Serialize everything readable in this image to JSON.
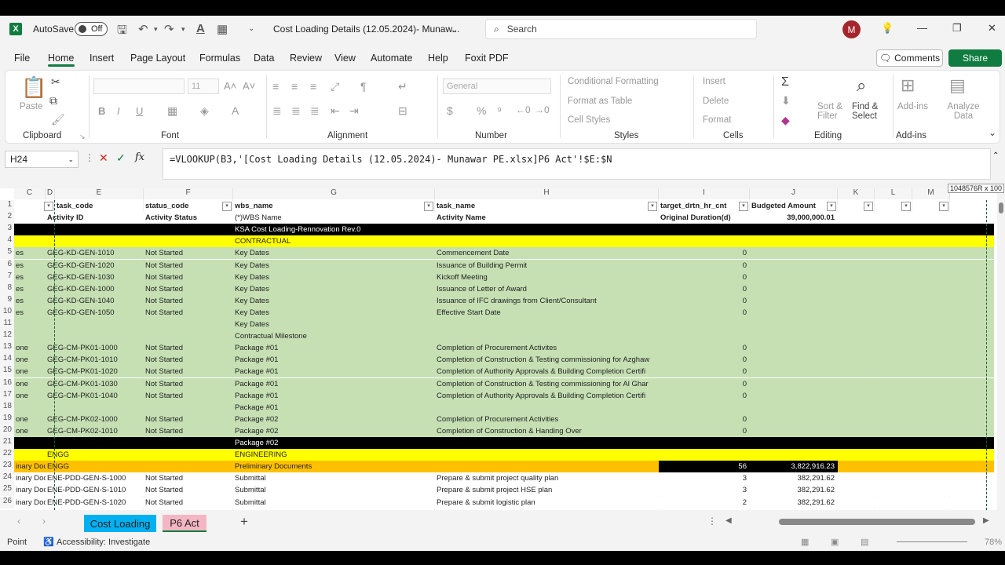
{
  "titlebar": {
    "autosave_label": "AutoSave",
    "autosave_state": "Off",
    "document_title": "Cost Loading Details (12.05.2024)- Munaw...",
    "search_placeholder": "Search",
    "avatar_initial": "M"
  },
  "menu": {
    "items": [
      "File",
      "Home",
      "Insert",
      "Page Layout",
      "Formulas",
      "Data",
      "Review",
      "View",
      "Automate",
      "Help",
      "Foxit PDF"
    ],
    "active": "Home",
    "comments_label": "Comments",
    "share_label": "Share"
  },
  "ribbon": {
    "clipboard": {
      "paste": "Paste",
      "label": "Clipboard"
    },
    "font": {
      "size": "11",
      "label": "Font"
    },
    "alignment": {
      "label": "Alignment"
    },
    "number": {
      "format": "General",
      "label": "Number"
    },
    "styles": {
      "cond_format": "Conditional Formatting",
      "format_table": "Format as Table",
      "cell_styles": "Cell Styles",
      "label": "Styles"
    },
    "cells": {
      "insert": "Insert",
      "delete": "Delete",
      "format": "Format",
      "label": "Cells"
    },
    "editing": {
      "sort_filter": "Sort & Filter",
      "find_select": "Find & Select",
      "label": "Editing"
    },
    "addins": {
      "addins": "Add-ins",
      "label": "Add-ins"
    },
    "analyze": {
      "label": "Analyze Data"
    }
  },
  "formula_bar": {
    "name_box": "H24",
    "formula": "=VLOOKUP(B3,'[Cost Loading Details (12.05.2024)- Munawar PE.xlsx]P6 Act'!$E:$N"
  },
  "grid": {
    "column_letters": [
      "C",
      "D",
      "E",
      "F",
      "G",
      "H",
      "I",
      "J",
      "K",
      "L",
      "M"
    ],
    "tooltip": "1048576R x 100",
    "header_row": {
      "task_code": "task_code",
      "status_code": "status_code",
      "wbs_name": "wbs_name",
      "task_name": "task_name",
      "target": "target_drtn_hr_cnt",
      "budget": "Budgeted Amount"
    },
    "rows": [
      {
        "n": "2",
        "c": "",
        "e": "Activity ID",
        "f": "Activity Status",
        "g": "(*)WBS Name",
        "h": "Activity Name",
        "i": "Original Duration(d)",
        "j": "39,000,000.01",
        "style": "sub"
      },
      {
        "n": "3",
        "c": "",
        "e": "",
        "f": "",
        "g": "KSA Cost Loading-Rennovation Rev.0",
        "h": "",
        "i": "",
        "j": "",
        "style": "black"
      },
      {
        "n": "4",
        "c": "",
        "e": "",
        "f": "",
        "g": "CONTRACTUAL",
        "h": "",
        "i": "",
        "j": "",
        "style": "yellow"
      },
      {
        "n": "5",
        "c": "es",
        "e": "GEG-KD-GEN-1010",
        "f": "Not Started",
        "g": "Key Dates",
        "h": "Commencement Date",
        "i": "0",
        "j": "",
        "style": "green"
      },
      {
        "n": "6",
        "c": "es",
        "e": "GEG-KD-GEN-1020",
        "f": "Not Started",
        "g": "Key Dates",
        "h": "Issuance of Building Permit",
        "i": "0",
        "j": "",
        "style": "green"
      },
      {
        "n": "7",
        "c": "es",
        "e": "GEG-KD-GEN-1030",
        "f": "Not Started",
        "g": "Key Dates",
        "h": "Kickoff Meeting",
        "i": "0",
        "j": "",
        "style": "green"
      },
      {
        "n": "8",
        "c": "es",
        "e": "GEG-KD-GEN-1000",
        "f": "Not Started",
        "g": "Key Dates",
        "h": "Issuance of Letter of Award",
        "i": "0",
        "j": "",
        "style": "green"
      },
      {
        "n": "9",
        "c": "es",
        "e": "GEG-KD-GEN-1040",
        "f": "Not Started",
        "g": "Key Dates",
        "h": "Issuance of IFC drawings from Client/Consultant",
        "i": "0",
        "j": "",
        "style": "green"
      },
      {
        "n": "10",
        "c": "es",
        "e": "GEG-KD-GEN-1050",
        "f": "Not Started",
        "g": "Key Dates",
        "h": "Effective Start Date",
        "i": "0",
        "j": "",
        "style": "green"
      },
      {
        "n": "11",
        "c": "",
        "e": "",
        "f": "",
        "g": "Key Dates",
        "h": "",
        "i": "",
        "j": "",
        "style": "green"
      },
      {
        "n": "12",
        "c": "",
        "e": "",
        "f": "",
        "g": "Contractual Milestone",
        "h": "",
        "i": "",
        "j": "",
        "style": "green"
      },
      {
        "n": "13",
        "c": "one",
        "e": "GEG-CM-PK01-1000",
        "f": "Not Started",
        "g": "Package #01",
        "h": "Completion of Procurement Activites",
        "i": "0",
        "j": "",
        "style": "green"
      },
      {
        "n": "14",
        "c": "one",
        "e": "GEG-CM-PK01-1010",
        "f": "Not Started",
        "g": "Package #01",
        "h": "Completion of Construction & Testing commissioning for Azghaw",
        "i": "0",
        "j": "",
        "style": "green"
      },
      {
        "n": "15",
        "c": "one",
        "e": "GEG-CM-PK01-1020",
        "f": "Not Started",
        "g": "Package #01",
        "h": "Completion of Authority Approvals & Building Completion Certifi",
        "i": "0",
        "j": "",
        "style": "green"
      },
      {
        "n": "16",
        "c": "one",
        "e": "GEG-CM-PK01-1030",
        "f": "Not Started",
        "g": "Package #01",
        "h": "Completion of Construction & Testing commissioning for Al Ghar",
        "i": "0",
        "j": "",
        "style": "green"
      },
      {
        "n": "17",
        "c": "one",
        "e": "GEG-CM-PK01-1040",
        "f": "Not Started",
        "g": "Package #01",
        "h": "Completion of Authority Approvals & Building Completion Certifi",
        "i": "0",
        "j": "",
        "style": "green"
      },
      {
        "n": "18",
        "c": "",
        "e": "",
        "f": "",
        "g": "Package #01",
        "h": "",
        "i": "",
        "j": "",
        "style": "green"
      },
      {
        "n": "19",
        "c": "one",
        "e": "GEG-CM-PK02-1000",
        "f": "Not Started",
        "g": "Package #02",
        "h": "Completion of Procurement Activities",
        "i": "0",
        "j": "",
        "style": "green"
      },
      {
        "n": "20",
        "c": "one",
        "e": "GEG-CM-PK02-1010",
        "f": "Not Started",
        "g": "Package #02",
        "h": "Completion of Construction & Handing Over",
        "i": "0",
        "j": "",
        "style": "green"
      },
      {
        "n": "21",
        "c": "",
        "e": "",
        "f": "",
        "g": "Package #02",
        "h": "",
        "i": "",
        "j": "",
        "style": "black"
      },
      {
        "n": "22",
        "c": "",
        "e": "ENGG",
        "f": "",
        "g": "ENGINEERING",
        "h": "",
        "i": "",
        "j": "",
        "style": "yellow"
      },
      {
        "n": "23",
        "c": "inary Doc",
        "e": "ENGG",
        "f": "",
        "g": "Preliminary Documents",
        "h": "",
        "i": "56",
        "j": "3,822,916.23",
        "style": "orange"
      },
      {
        "n": "24",
        "c": "inary Doc",
        "e": "ENE-PDD-GEN-S-1000",
        "f": "Not Started",
        "g": "Submittal",
        "h": "Prepare & submit project quality plan",
        "i": "3",
        "j": "382,291.62",
        "style": "white"
      },
      {
        "n": "25",
        "c": "inary Doc",
        "e": "ENE-PDD-GEN-S-1010",
        "f": "Not Started",
        "g": "Submittal",
        "h": "Prepare & submit project HSE plan",
        "i": "3",
        "j": "382,291.62",
        "style": "white"
      },
      {
        "n": "26",
        "c": "inary Doc",
        "e": "ENE-PDD-GEN-S-1020",
        "f": "Not Started",
        "g": "Submittal",
        "h": "Prepare & submit logistic plan",
        "i": "2",
        "j": "382,291.62",
        "style": "white"
      }
    ]
  },
  "sheets": {
    "tabs": [
      "Cost Loading",
      "P6 Act"
    ],
    "active": "P6 Act"
  },
  "status": {
    "mode": "Point",
    "accessibility": "Accessibility: Investigate",
    "zoom": "78%"
  },
  "colors": {
    "excel_green": "#107c41",
    "row_green": "#c6e0b4",
    "row_yellow": "#ffff00",
    "row_orange": "#ffc000",
    "row_black": "#000000",
    "tab_cyan": "#00b0f0",
    "tab_pink": "#f4b6c2"
  }
}
